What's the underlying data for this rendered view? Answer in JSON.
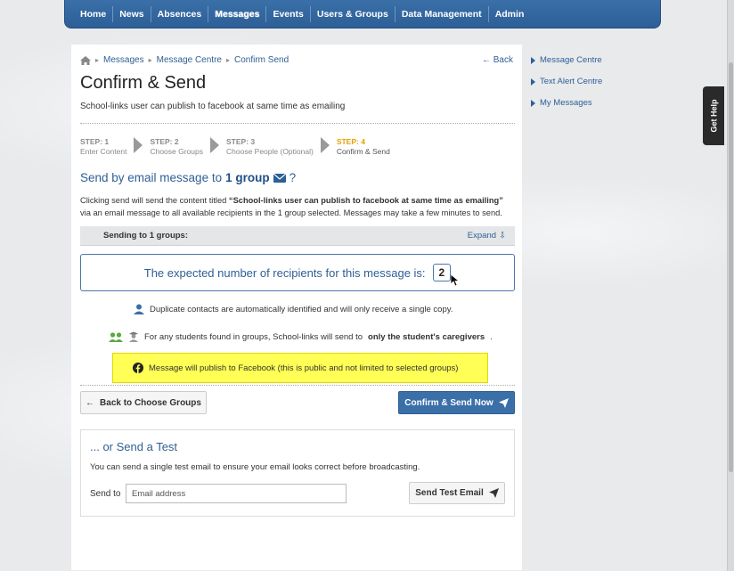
{
  "nav": {
    "items": [
      "Home",
      "News",
      "Absences",
      "Messages",
      "Events",
      "Users & Groups",
      "Data Management",
      "Admin"
    ],
    "active": "Messages"
  },
  "breadcrumb": {
    "items": [
      "Messages",
      "Message Centre",
      "Confirm Send"
    ],
    "back": "Back"
  },
  "page": {
    "title": "Confirm & Send",
    "subtitle": "School-links user can publish to facebook at same time as emailing"
  },
  "steps": [
    {
      "num": "STEP: 1",
      "label": "Enter Content"
    },
    {
      "num": "STEP: 2",
      "label": "Choose Groups"
    },
    {
      "num": "STEP: 3",
      "label": "Choose People (Optional)"
    },
    {
      "num": "STEP: 4",
      "label": "Confirm & Send"
    }
  ],
  "send": {
    "prefix": "Send by email message to",
    "group_count": "1 group",
    "question": "?",
    "desc_1": "Clicking send will send the content titled ",
    "desc_title": "“School-links user can publish to facebook at same time as emailing”",
    "desc_2": "via an email message to all available recipients in the 1 group selected. Messages may take a few minutes to send."
  },
  "sending_bar": {
    "label": "Sending to 1 groups:",
    "expand": "Expand"
  },
  "recipients": {
    "label": "The expected number of recipients for this message is:",
    "count": "2"
  },
  "info": {
    "duplicates": "Duplicate contacts are automatically identified and will only receive a single copy.",
    "students_1": "For any students found in groups, School-links will send to ",
    "students_bold": "only the student's caregivers",
    "students_2": ".",
    "facebook": "Message will publish to Facebook (this is public and not limited to selected groups)"
  },
  "buttons": {
    "back": "Back to Choose Groups",
    "confirm": "Confirm & Send Now"
  },
  "test": {
    "title": "... or Send a Test",
    "desc": "You can send a single test email to ensure your email looks correct before broadcasting.",
    "send_to": "Send to",
    "placeholder": "Email address",
    "button": "Send Test Email"
  },
  "sidebar": {
    "links": [
      "Message Centre",
      "Text Alert Centre",
      "My Messages"
    ]
  },
  "help": {
    "label": "Get Help"
  },
  "colors": {
    "accent": "#3a6fa8",
    "step_current": "#e8a000",
    "highlight": "#ffff55"
  }
}
